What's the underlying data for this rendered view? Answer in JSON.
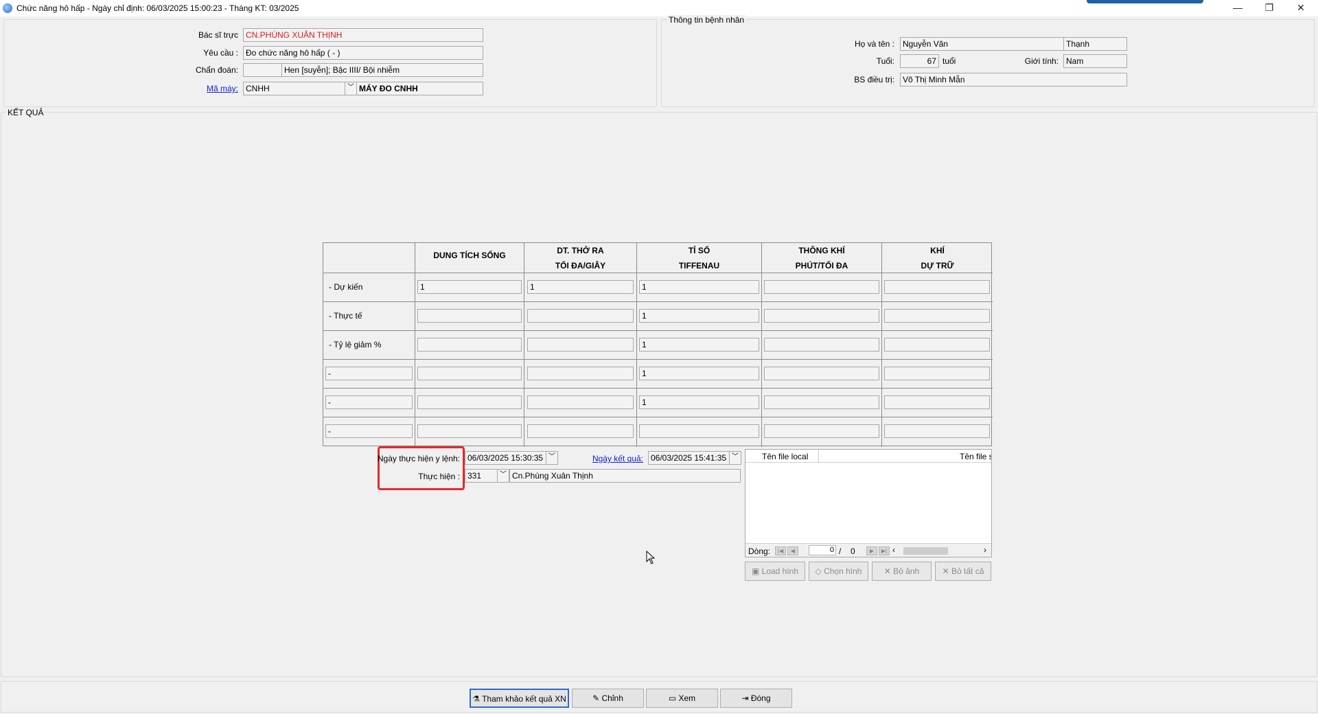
{
  "window": {
    "title": "Chức năng hô hấp - Ngày chỉ định: 06/03/2025 15:00:23 - Tháng KT: 03/2025",
    "minimize": "—",
    "restore": "❐",
    "close": "✕"
  },
  "request": {
    "doctor_label": "Bác sĩ trực",
    "doctor_value": "CN.PHÙNG XUÂN THỊNH",
    "request_label": "Yêu cầu :",
    "request_value": "Đo chức năng hô hấp ( - )",
    "diagnosis_label": "Chẩn đoán:",
    "diagnosis_code": "",
    "diagnosis_value": "Hen [suyễn]; Bậc IIII/ Bội nhiễm",
    "machine_label": "Mã máy:",
    "machine_code": "CNHH",
    "machine_name": "MÁY ĐO CNHH"
  },
  "patient": {
    "group_title": "Thông tin bệnh nhân",
    "name_label": "Họ và tên :",
    "name_value": "Nguyễn Văn",
    "name_value2": "Thạnh",
    "age_label": "Tuổi:",
    "age_value": "67",
    "age_unit": "tuổi",
    "gender_label": "Giới tính:",
    "gender_value": "Nam",
    "treating_label": "BS điều trị:",
    "treating_value": "Võ Thị Minh Mẫn"
  },
  "result": {
    "group_title": "KẾT QUẢ",
    "headers": [
      {
        "line1": "DUNG TÍCH SỐNG",
        "line2": ""
      },
      {
        "line1": "DT. THỞ RA",
        "line2": "TỐI ĐA/GIÂY"
      },
      {
        "line1": "TỈ SỐ",
        "line2": "TIFFENAU"
      },
      {
        "line1": "THÔNG KHÍ",
        "line2": "PHÚT/TỐI ĐA"
      },
      {
        "line1": "KHÍ",
        "line2": "DỰ TRỮ"
      }
    ],
    "rows": [
      {
        "label": "- Dự kiến",
        "label_field": false,
        "values": [
          "1",
          "1",
          "1",
          "",
          ""
        ]
      },
      {
        "label": "- Thực tế",
        "label_field": false,
        "values": [
          "",
          "",
          "1",
          "",
          ""
        ]
      },
      {
        "label": "- Tỷ lệ giảm %",
        "label_field": false,
        "values": [
          "",
          "",
          "1",
          "",
          ""
        ]
      },
      {
        "label": "-",
        "label_field": true,
        "values": [
          "",
          "",
          "1",
          "",
          ""
        ]
      },
      {
        "label": "-",
        "label_field": true,
        "values": [
          "",
          "",
          "1",
          "",
          ""
        ]
      },
      {
        "label": "-",
        "label_field": true,
        "values": [
          "",
          "",
          "",
          "",
          ""
        ]
      }
    ]
  },
  "execution": {
    "order_date_label": "Ngày thực hiện y lệnh:",
    "order_date_value": "06/03/2025  15:30:35",
    "result_date_label": "Ngày kết quả:",
    "result_date_value": "06/03/2025  15:41:35",
    "performer_label": "Thực hiện :",
    "performer_code": "331",
    "performer_name": "Cn.Phùng Xuân Thịnh"
  },
  "files": {
    "col_local": "Tên file local",
    "col_server": "Tên file se",
    "row_label": "Dòng:",
    "page_current": "0",
    "page_sep": "/",
    "page_total": "0",
    "load_btn": "Load hình",
    "choose_btn": "Chọn hình",
    "remove_btn": "Bỏ ảnh",
    "remove_all_btn": "Bỏ tất cả"
  },
  "footer": {
    "reference_btn": "Tham khảo kết quả XN",
    "edit_btn": "Chỉnh",
    "view_btn": "Xem",
    "close_btn": "Đóng"
  }
}
